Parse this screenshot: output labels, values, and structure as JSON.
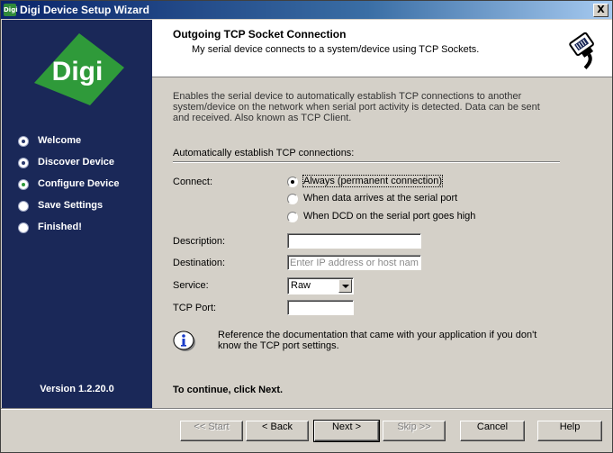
{
  "window": {
    "title": "Digi Device Setup Wizard",
    "close_label": "X",
    "app_icon_text": "Digi"
  },
  "sidebar": {
    "logo_text": "Digi",
    "steps": [
      {
        "label": "Welcome",
        "state": "done"
      },
      {
        "label": "Discover Device",
        "state": "done"
      },
      {
        "label": "Configure Device",
        "state": "active"
      },
      {
        "label": "Save Settings",
        "state": "pending"
      },
      {
        "label": "Finished!",
        "state": "pending"
      }
    ],
    "version": "Version 1.2.20.0"
  },
  "header": {
    "title": "Outgoing TCP Socket Connection",
    "subtitle": "My serial device connects to a system/device using TCP Sockets."
  },
  "content": {
    "intro": "Enables the serial device to automatically establish TCP connections to another system/device on the network when serial port activity is detected. Data can be sent and received. Also known as TCP Client.",
    "section_label": "Automatically establish TCP connections:",
    "connect_label": "Connect:",
    "connect_options": [
      {
        "label": "Always (permanent connection)",
        "checked": true
      },
      {
        "label": "When data arrives at the serial port",
        "checked": false
      },
      {
        "label": "When DCD on the serial port goes high",
        "checked": false
      }
    ],
    "description_label": "Description:",
    "description_value": "",
    "destination_label": "Destination:",
    "destination_placeholder": "Enter IP address or host name",
    "service_label": "Service:",
    "service_value": "Raw",
    "tcp_port_label": "TCP Port:",
    "tcp_port_value": "",
    "info_text": "Reference the documentation that came with your application if you don't know the TCP port settings.",
    "continue_text": "To continue, click Next."
  },
  "buttons": {
    "start": "<< Start",
    "back": "< Back",
    "next": "Next >",
    "skip": "Skip >>",
    "cancel": "Cancel",
    "help": "Help"
  },
  "colors": {
    "sidebar_bg": "#1a2858",
    "logo_green": "#2f9a3a",
    "title_bar": "#0a246a"
  }
}
